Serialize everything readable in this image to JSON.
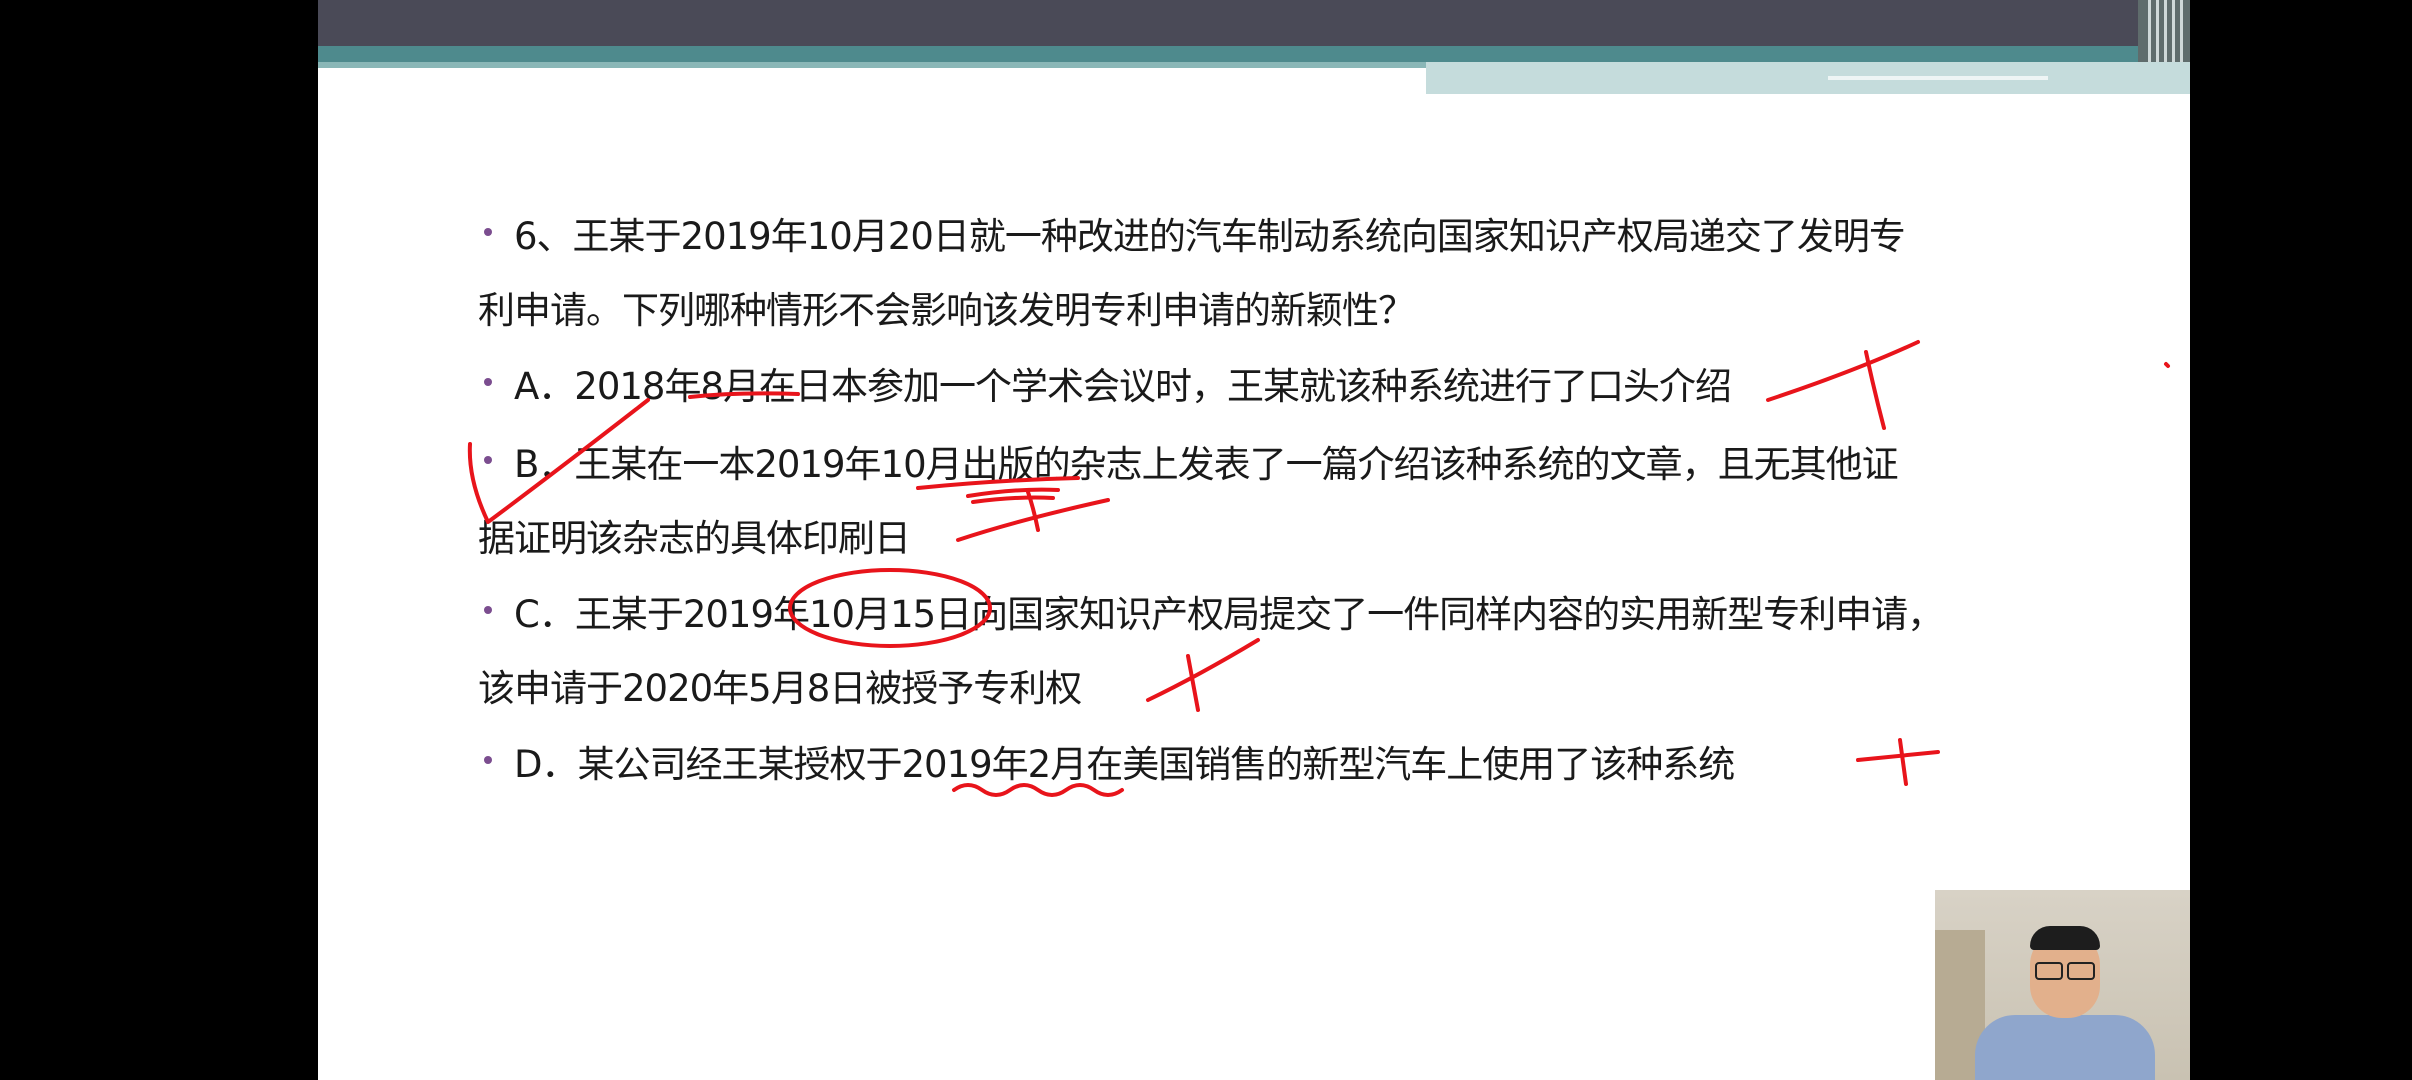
{
  "question": {
    "line1": "6、王某于2019年10月20日就一种改进的汽车制动系统向国家知识产权局递交了发明专",
    "line2": "利申请。下列哪种情形不会影响该发明专利申请的新颖性？"
  },
  "options": {
    "a": "A．2018年8月在日本参加一个学术会议时，王某就该种系统进行了口头介绍",
    "b_line1": "B．王某在一本2019年10月出版的杂志上发表了一篇介绍该种系统的文章，且无其他证",
    "b_line2": "据证明该杂志的具体印刷日",
    "c_line1": "C．王某于2019年10月15日向国家知识产权局提交了一件同样内容的实用新型专利申请，",
    "c_line2": "该申请于2020年5月8日被授予专利权",
    "d": "D．某公司经王某授权于2019年2月在美国销售的新型汽车上使用了该种系统"
  },
  "colors": {
    "bullet": "#7b4d8f",
    "annotation": "#e8141b",
    "header_dark": "#4a4a57",
    "header_teal": "#4e8a8d"
  }
}
